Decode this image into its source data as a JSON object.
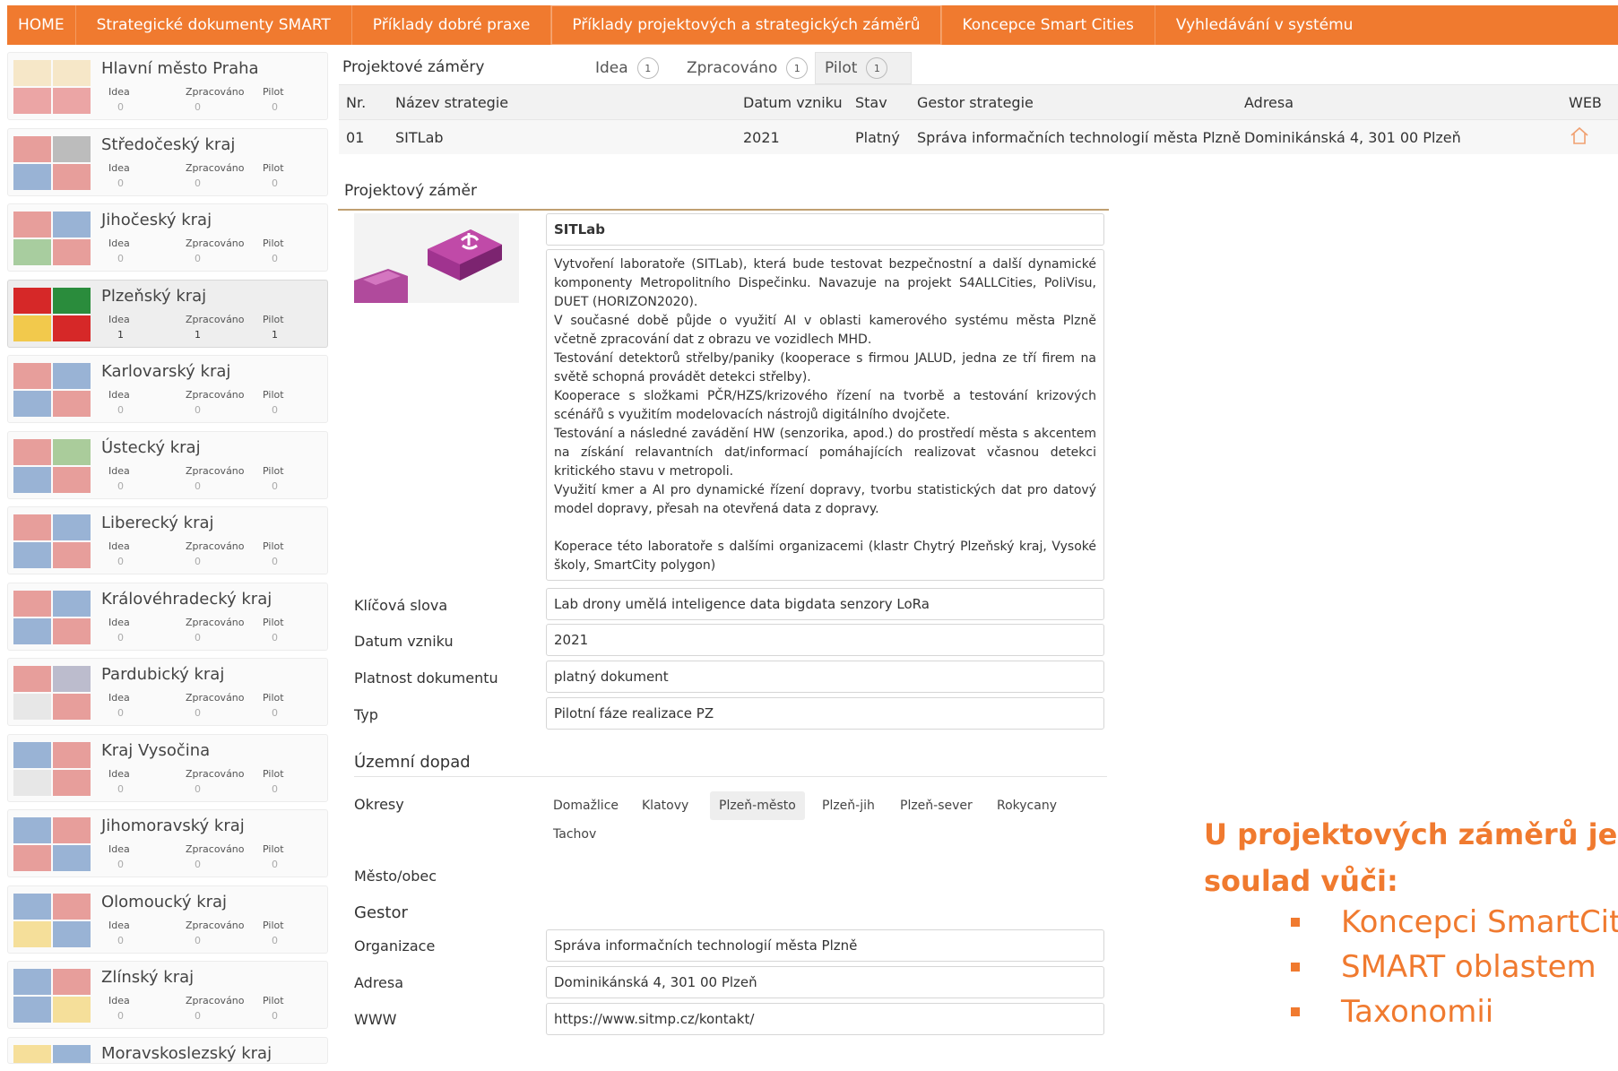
{
  "nav": {
    "items": [
      "HOME",
      "Strategické dokumenty SMART",
      "Příklady dobré praxe",
      "Příklady projektových a strategických záměrů",
      "Koncepce Smart Cities",
      "Vyhledávání v systému"
    ]
  },
  "sidebar": {
    "stat_labels": [
      "Idea",
      "Zpracováno",
      "Pilot"
    ],
    "regions": [
      {
        "name": "Hlavní město Praha",
        "values": [
          "0",
          "0",
          "0"
        ]
      },
      {
        "name": "Středočeský kraj",
        "values": [
          "0",
          "0",
          "0"
        ]
      },
      {
        "name": "Jihočeský kraj",
        "values": [
          "0",
          "0",
          "0"
        ]
      },
      {
        "name": "Plzeňský kraj",
        "values": [
          "1",
          "1",
          "1"
        ]
      },
      {
        "name": "Karlovarský kraj",
        "values": [
          "0",
          "0",
          "0"
        ]
      },
      {
        "name": "Ústecký kraj",
        "values": [
          "0",
          "0",
          "0"
        ]
      },
      {
        "name": "Liberecký kraj",
        "values": [
          "0",
          "0",
          "0"
        ]
      },
      {
        "name": "Královéhradecký kraj",
        "values": [
          "0",
          "0",
          "0"
        ]
      },
      {
        "name": "Pardubický kraj",
        "values": [
          "0",
          "0",
          "0"
        ]
      },
      {
        "name": "Kraj Vysočina",
        "values": [
          "0",
          "0",
          "0"
        ]
      },
      {
        "name": "Jihomoravský kraj",
        "values": [
          "0",
          "0",
          "0"
        ]
      },
      {
        "name": "Olomoucký kraj",
        "values": [
          "0",
          "0",
          "0"
        ]
      },
      {
        "name": "Zlínský kraj",
        "values": [
          "0",
          "0",
          "0"
        ]
      },
      {
        "name": "Moravskoslezský kraj",
        "values": [
          "",
          "",
          ""
        ]
      }
    ]
  },
  "projects": {
    "section_label": "Projektové záměry",
    "tabs": [
      {
        "label": "Idea",
        "count": "1"
      },
      {
        "label": "Zpracováno",
        "count": "1"
      },
      {
        "label": "Pilot",
        "count": "1"
      }
    ],
    "columns": [
      "Nr.",
      "Název strategie",
      "Datum vzniku",
      "Stav",
      "Gestor strategie",
      "Adresa",
      "WEB"
    ],
    "rows": [
      {
        "nr": "01",
        "name": "SITLab",
        "date": "2021",
        "state": "Platný",
        "gestor": "Správa informačních technologií města Plzně",
        "address": "Dominikánská 4, 301 00 Plzeň"
      }
    ]
  },
  "detail": {
    "title": "Projektový záměr",
    "project_name": "SITLab",
    "description": [
      "Vytvoření laboratoře (SITLab), která bude testovat bezpečnostní a další dynamické komponenty Metropolitního Dispečinku. Navazuje na projekt S4ALLCities, PoliVisu, DUET (HORIZON2020).",
      "V současné době půjde o využití AI v oblasti kamerového systému města Plzně včetně zpracování dat z obrazu ve vozidlech MHD.",
      "Testování detektorů střelby/paniky (kooperace s firmou JALUD, jedna ze tří firem na světě schopná provádět detekci střelby).",
      "Kooperace s složkami PČR/HZS/krizového řízení na tvorbě a testování krizových scénářů s využitím modelovacích nástrojů digitálního dvojčete.",
      "Testování a následné zavádění HW (senzorika, apod.) do prostředí města s akcentem na získání relavantních dat/informací pomáhajících realizovat včasnou detekci kritického stavu v metropoli.",
      "Využití kmer a AI pro dynamické řízení dopravy, tvorbu statistických dat pro datový model dopravy, přesah na otevřená data z dopravy.",
      "",
      "Koperace této laboratoře s dalšími organizacemi (klastr Chytrý Plzeňský kraj, Vysoké školy, SmartCity polygon)"
    ],
    "fields": [
      {
        "label": "Klíčová slova",
        "value": "Lab drony umělá inteligence data bigdata senzory LoRa"
      },
      {
        "label": "Datum vzniku",
        "value": "2021"
      },
      {
        "label": "Platnost dokumentu",
        "value": "platný dokument"
      },
      {
        "label": "Typ",
        "value": "Pilotní fáze realizace PZ"
      }
    ],
    "territorial": {
      "heading": "Územní dopad",
      "districts_label": "Okresy",
      "districts": [
        "Domažlice",
        "Klatovy",
        "Plzeň-město",
        "Plzeň-jih",
        "Plzeň-sever",
        "Rokycany",
        "Tachov"
      ],
      "city_label": "Město/obec"
    },
    "gestor": {
      "heading": "Gestor",
      "fields": [
        {
          "label": "Organizace",
          "value": "Správa informačních technologií města Plzně"
        },
        {
          "label": "Adresa",
          "value": "Dominikánská 4, 301 00 Plzeň"
        },
        {
          "label": "WWW",
          "value": "https://www.sitmp.cz/kontakt/"
        }
      ]
    }
  },
  "callout": {
    "line1": "U projektových záměrů je",
    "line2": "soulad vůči:",
    "bullets": [
      "Koncepci SmartCities",
      "SMART oblastem",
      "Taxonomii"
    ]
  },
  "colors": {
    "accent": "#f07a2f"
  }
}
